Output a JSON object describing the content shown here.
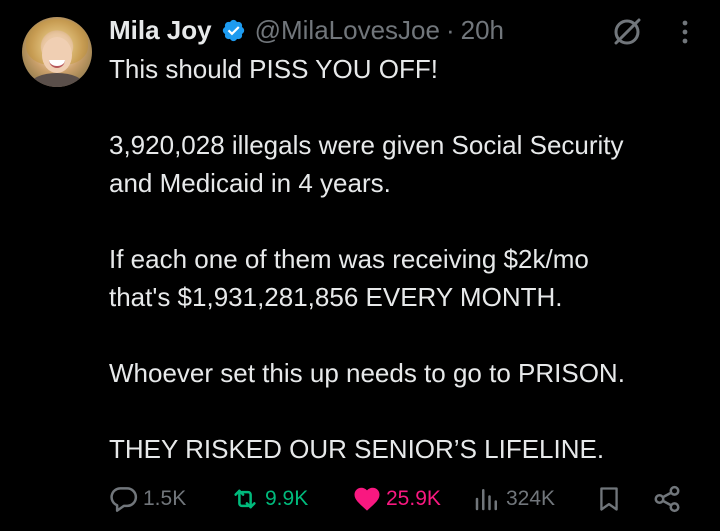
{
  "post": {
    "author": {
      "name": "Mila Joy",
      "handle": "@MilaLovesJoe",
      "separator": "·",
      "time": "20h",
      "verified": true,
      "avatar": "profile-photo"
    },
    "text": {
      "line1": "This should PISS YOU OFF!",
      "para2_line1": "3,920,028 illegals were given Social Security",
      "para2_line2": "and Medicaid in 4 years.",
      "para3_line1": "If each one of them was receiving $2k/mo",
      "para3_line2": "that's $1,931,281,856 EVERY MONTH.",
      "para4": "Whoever set this up needs to go to PRISON.",
      "para5": "THEY RISKED OUR SENIOR’S LIFELINE."
    },
    "actions": {
      "replies": "1.5K",
      "reposts": "9.9K",
      "likes": "25.9K",
      "views": "324K"
    },
    "icons": {
      "verified": "verified-badge-icon",
      "grok": "grok-icon",
      "more": "more-icon",
      "reply": "reply-icon",
      "repost": "repost-icon",
      "like": "heart-icon",
      "views": "views-chart-icon",
      "bookmark": "bookmark-icon",
      "share": "share-icon"
    },
    "colors": {
      "background": "#000000",
      "text": "#e7e9ea",
      "muted": "#71767b",
      "verified": "#1d9bf0",
      "repost_active": "#00ba7c",
      "like_active": "#f91880"
    }
  }
}
